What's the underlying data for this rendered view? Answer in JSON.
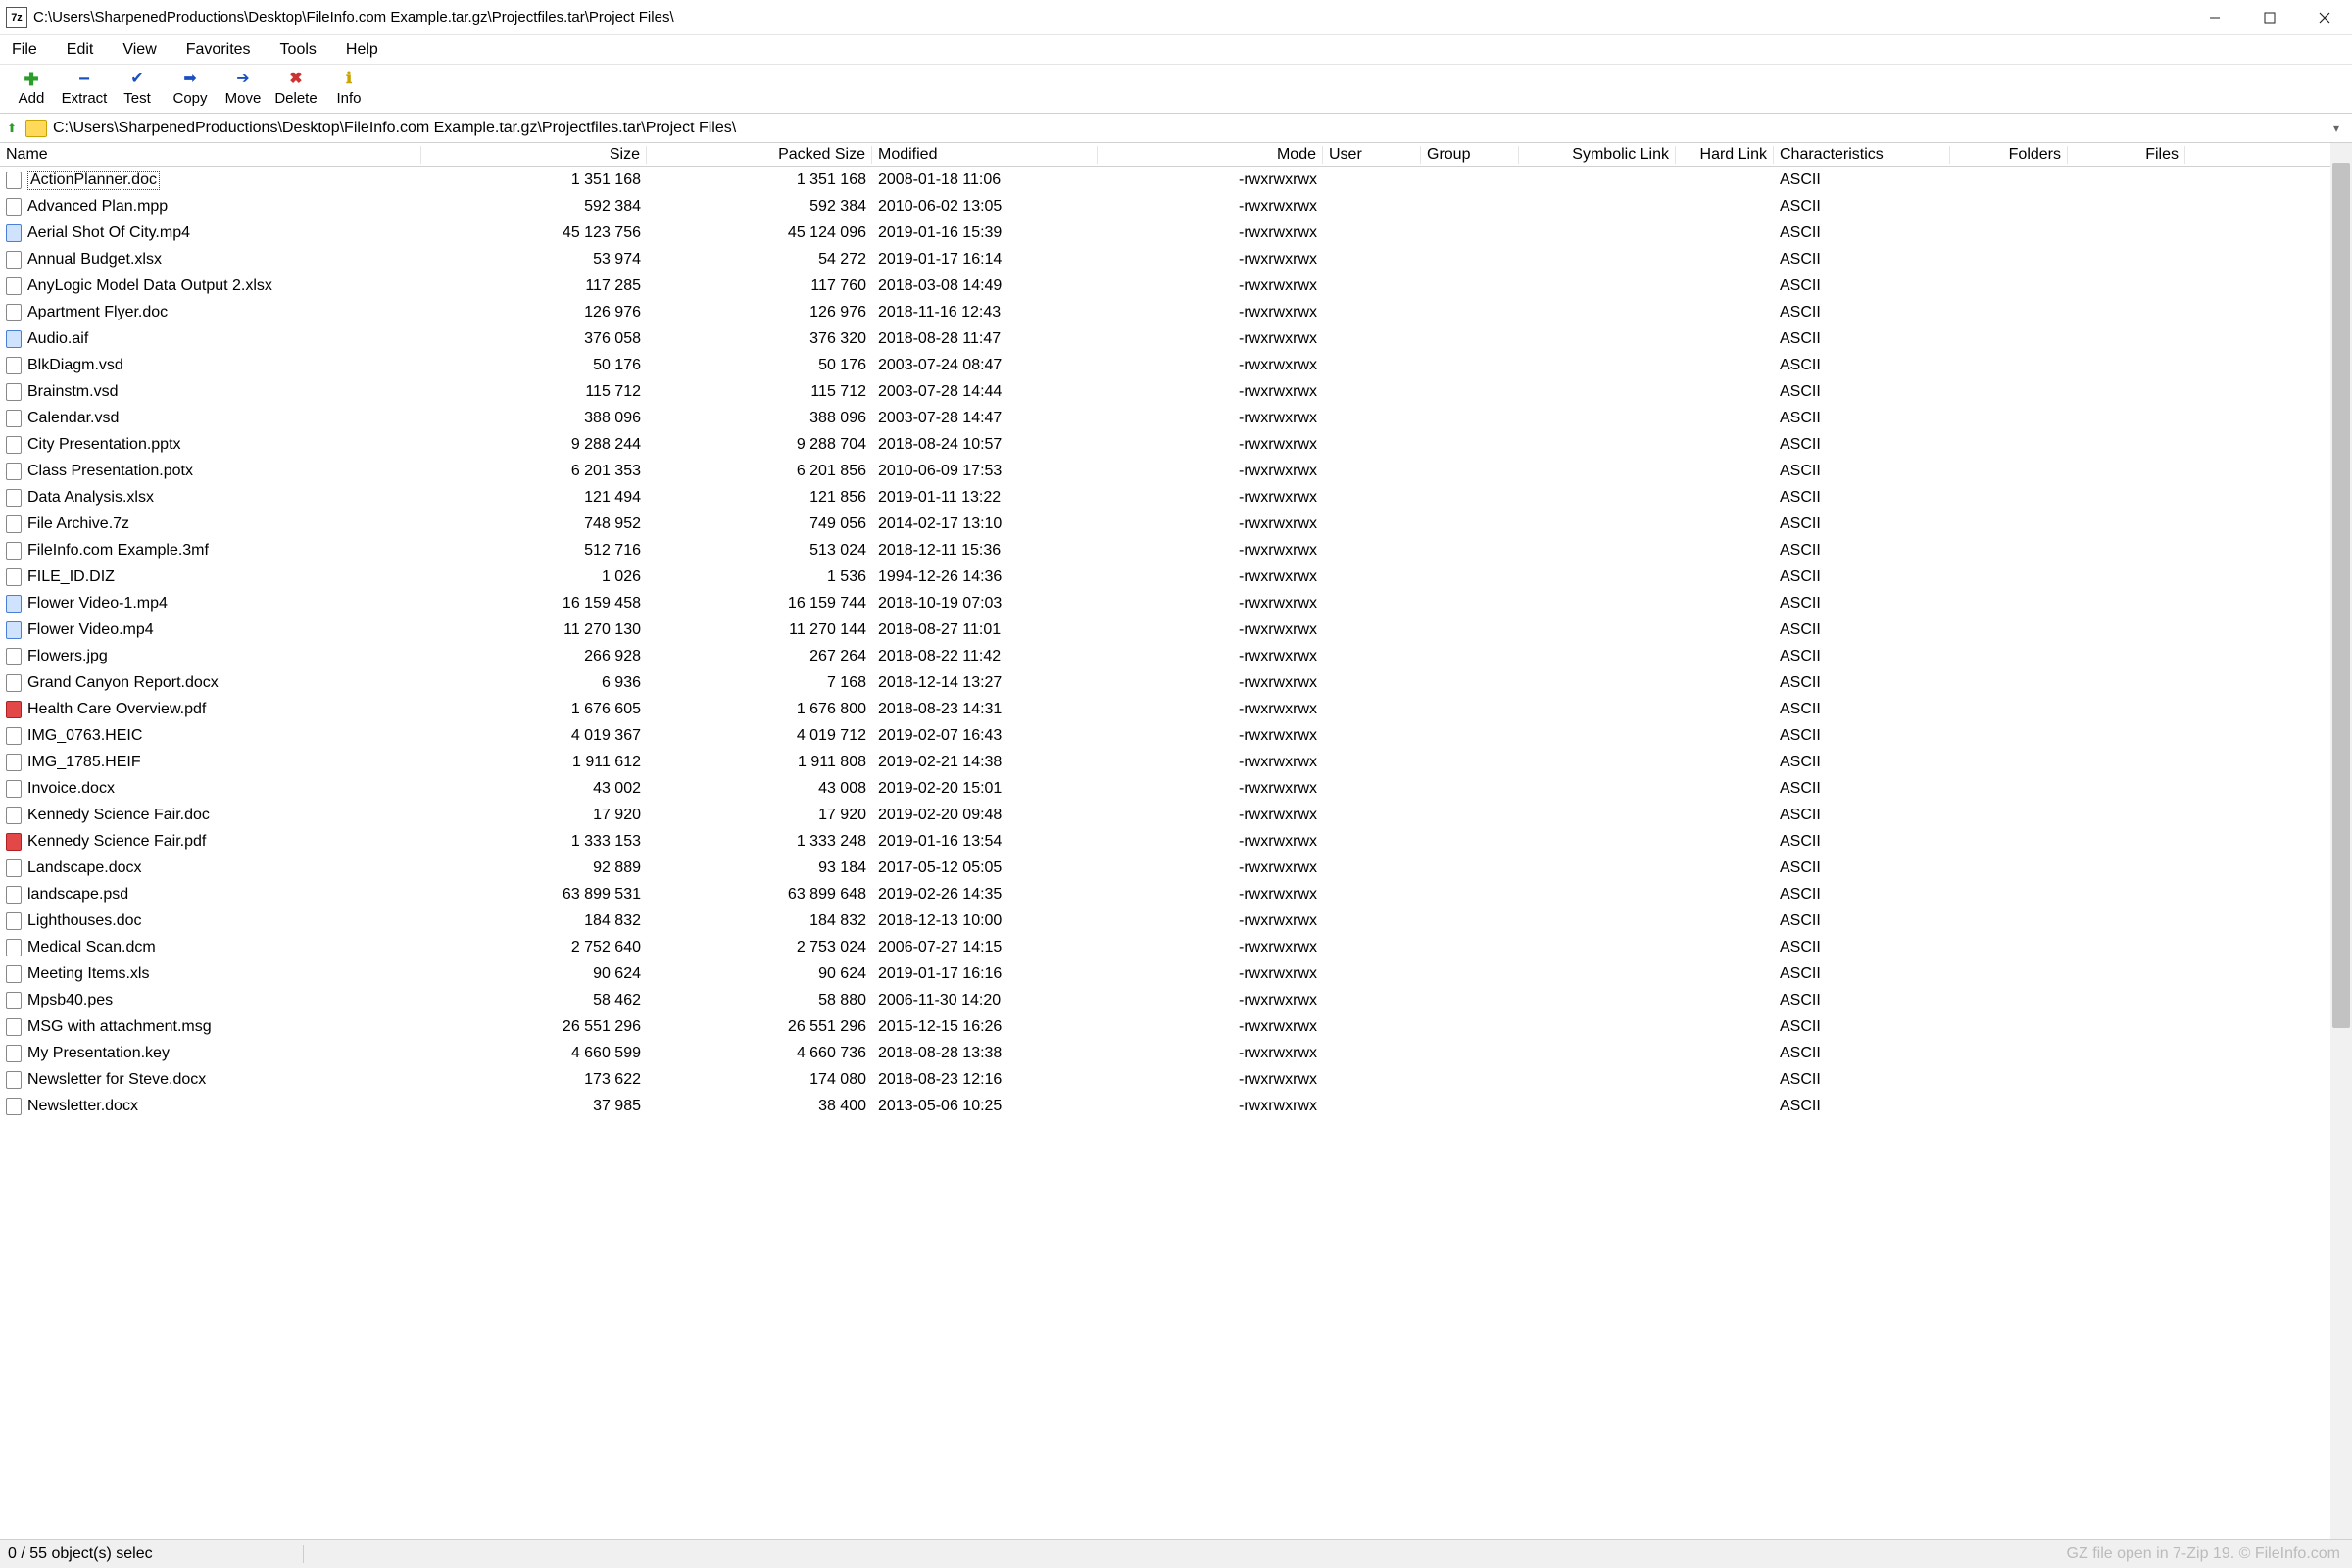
{
  "titlebar": {
    "icon_text": "7z",
    "title": "C:\\Users\\SharpenedProductions\\Desktop\\FileInfo.com Example.tar.gz\\Projectfiles.tar\\Project Files\\"
  },
  "menu": [
    "File",
    "Edit",
    "View",
    "Favorites",
    "Tools",
    "Help"
  ],
  "toolbar": [
    {
      "id": "add",
      "label": "Add",
      "glyph": "✚",
      "cls": "add"
    },
    {
      "id": "extract",
      "label": "Extract",
      "glyph": "−",
      "cls": "extract"
    },
    {
      "id": "test",
      "label": "Test",
      "glyph": "✔",
      "cls": "test"
    },
    {
      "id": "copy",
      "label": "Copy",
      "glyph": "➡",
      "cls": "copy"
    },
    {
      "id": "move",
      "label": "Move",
      "glyph": "➔",
      "cls": "move"
    },
    {
      "id": "delete",
      "label": "Delete",
      "glyph": "✖",
      "cls": "delete"
    },
    {
      "id": "info",
      "label": "Info",
      "glyph": "ℹ",
      "cls": "info"
    }
  ],
  "addressbar": {
    "path": "C:\\Users\\SharpenedProductions\\Desktop\\FileInfo.com Example.tar.gz\\Projectfiles.tar\\Project Files\\"
  },
  "columns": [
    "Name",
    "Size",
    "Packed Size",
    "Modified",
    "Mode",
    "User",
    "Group",
    "Symbolic Link",
    "Hard Link",
    "Characteristics",
    "Folders",
    "Files"
  ],
  "rows": [
    {
      "name": "ActionPlanner.doc",
      "icon": "",
      "size": "1 351 168",
      "psize": "1 351 168",
      "mod": "2008-01-18 11:06",
      "mode": "-rwxrwxrwx",
      "char": "ASCII",
      "selected": true
    },
    {
      "name": "Advanced Plan.mpp",
      "icon": "",
      "size": "592 384",
      "psize": "592 384",
      "mod": "2010-06-02 13:05",
      "mode": "-rwxrwxrwx",
      "char": "ASCII"
    },
    {
      "name": "Aerial Shot Of City.mp4",
      "icon": "blue",
      "size": "45 123 756",
      "psize": "45 124 096",
      "mod": "2019-01-16 15:39",
      "mode": "-rwxrwxrwx",
      "char": "ASCII"
    },
    {
      "name": "Annual Budget.xlsx",
      "icon": "",
      "size": "53 974",
      "psize": "54 272",
      "mod": "2019-01-17 16:14",
      "mode": "-rwxrwxrwx",
      "char": "ASCII"
    },
    {
      "name": "AnyLogic Model Data Output 2.xlsx",
      "icon": "",
      "size": "117 285",
      "psize": "117 760",
      "mod": "2018-03-08 14:49",
      "mode": "-rwxrwxrwx",
      "char": "ASCII"
    },
    {
      "name": "Apartment Flyer.doc",
      "icon": "",
      "size": "126 976",
      "psize": "126 976",
      "mod": "2018-11-16 12:43",
      "mode": "-rwxrwxrwx",
      "char": "ASCII"
    },
    {
      "name": "Audio.aif",
      "icon": "blue",
      "size": "376 058",
      "psize": "376 320",
      "mod": "2018-08-28 11:47",
      "mode": "-rwxrwxrwx",
      "char": "ASCII"
    },
    {
      "name": "BlkDiagm.vsd",
      "icon": "",
      "size": "50 176",
      "psize": "50 176",
      "mod": "2003-07-24 08:47",
      "mode": "-rwxrwxrwx",
      "char": "ASCII"
    },
    {
      "name": "Brainstm.vsd",
      "icon": "",
      "size": "115 712",
      "psize": "115 712",
      "mod": "2003-07-28 14:44",
      "mode": "-rwxrwxrwx",
      "char": "ASCII"
    },
    {
      "name": "Calendar.vsd",
      "icon": "",
      "size": "388 096",
      "psize": "388 096",
      "mod": "2003-07-28 14:47",
      "mode": "-rwxrwxrwx",
      "char": "ASCII"
    },
    {
      "name": "City Presentation.pptx",
      "icon": "",
      "size": "9 288 244",
      "psize": "9 288 704",
      "mod": "2018-08-24 10:57",
      "mode": "-rwxrwxrwx",
      "char": "ASCII"
    },
    {
      "name": "Class Presentation.potx",
      "icon": "",
      "size": "6 201 353",
      "psize": "6 201 856",
      "mod": "2010-06-09 17:53",
      "mode": "-rwxrwxrwx",
      "char": "ASCII"
    },
    {
      "name": "Data Analysis.xlsx",
      "icon": "",
      "size": "121 494",
      "psize": "121 856",
      "mod": "2019-01-11 13:22",
      "mode": "-rwxrwxrwx",
      "char": "ASCII"
    },
    {
      "name": "File Archive.7z",
      "icon": "",
      "size": "748 952",
      "psize": "749 056",
      "mod": "2014-02-17 13:10",
      "mode": "-rwxrwxrwx",
      "char": "ASCII"
    },
    {
      "name": "FileInfo.com Example.3mf",
      "icon": "",
      "size": "512 716",
      "psize": "513 024",
      "mod": "2018-12-11 15:36",
      "mode": "-rwxrwxrwx",
      "char": "ASCII"
    },
    {
      "name": "FILE_ID.DIZ",
      "icon": "",
      "size": "1 026",
      "psize": "1 536",
      "mod": "1994-12-26 14:36",
      "mode": "-rwxrwxrwx",
      "char": "ASCII"
    },
    {
      "name": "Flower Video-1.mp4",
      "icon": "blue",
      "size": "16 159 458",
      "psize": "16 159 744",
      "mod": "2018-10-19 07:03",
      "mode": "-rwxrwxrwx",
      "char": "ASCII"
    },
    {
      "name": "Flower Video.mp4",
      "icon": "blue",
      "size": "11 270 130",
      "psize": "11 270 144",
      "mod": "2018-08-27 11:01",
      "mode": "-rwxrwxrwx",
      "char": "ASCII"
    },
    {
      "name": "Flowers.jpg",
      "icon": "",
      "size": "266 928",
      "psize": "267 264",
      "mod": "2018-08-22 11:42",
      "mode": "-rwxrwxrwx",
      "char": "ASCII"
    },
    {
      "name": "Grand Canyon Report.docx",
      "icon": "",
      "size": "6 936",
      "psize": "7 168",
      "mod": "2018-12-14 13:27",
      "mode": "-rwxrwxrwx",
      "char": "ASCII"
    },
    {
      "name": "Health Care Overview.pdf",
      "icon": "pdf",
      "size": "1 676 605",
      "psize": "1 676 800",
      "mod": "2018-08-23 14:31",
      "mode": "-rwxrwxrwx",
      "char": "ASCII"
    },
    {
      "name": "IMG_0763.HEIC",
      "icon": "",
      "size": "4 019 367",
      "psize": "4 019 712",
      "mod": "2019-02-07 16:43",
      "mode": "-rwxrwxrwx",
      "char": "ASCII"
    },
    {
      "name": "IMG_1785.HEIF",
      "icon": "",
      "size": "1 911 612",
      "psize": "1 911 808",
      "mod": "2019-02-21 14:38",
      "mode": "-rwxrwxrwx",
      "char": "ASCII"
    },
    {
      "name": "Invoice.docx",
      "icon": "",
      "size": "43 002",
      "psize": "43 008",
      "mod": "2019-02-20 15:01",
      "mode": "-rwxrwxrwx",
      "char": "ASCII"
    },
    {
      "name": "Kennedy Science Fair.doc",
      "icon": "",
      "size": "17 920",
      "psize": "17 920",
      "mod": "2019-02-20 09:48",
      "mode": "-rwxrwxrwx",
      "char": "ASCII"
    },
    {
      "name": "Kennedy Science Fair.pdf",
      "icon": "pdf",
      "size": "1 333 153",
      "psize": "1 333 248",
      "mod": "2019-01-16 13:54",
      "mode": "-rwxrwxrwx",
      "char": "ASCII"
    },
    {
      "name": "Landscape.docx",
      "icon": "",
      "size": "92 889",
      "psize": "93 184",
      "mod": "2017-05-12 05:05",
      "mode": "-rwxrwxrwx",
      "char": "ASCII"
    },
    {
      "name": "landscape.psd",
      "icon": "",
      "size": "63 899 531",
      "psize": "63 899 648",
      "mod": "2019-02-26 14:35",
      "mode": "-rwxrwxrwx",
      "char": "ASCII"
    },
    {
      "name": "Lighthouses.doc",
      "icon": "",
      "size": "184 832",
      "psize": "184 832",
      "mod": "2018-12-13 10:00",
      "mode": "-rwxrwxrwx",
      "char": "ASCII"
    },
    {
      "name": "Medical Scan.dcm",
      "icon": "",
      "size": "2 752 640",
      "psize": "2 753 024",
      "mod": "2006-07-27 14:15",
      "mode": "-rwxrwxrwx",
      "char": "ASCII"
    },
    {
      "name": "Meeting Items.xls",
      "icon": "",
      "size": "90 624",
      "psize": "90 624",
      "mod": "2019-01-17 16:16",
      "mode": "-rwxrwxrwx",
      "char": "ASCII"
    },
    {
      "name": "Mpsb40.pes",
      "icon": "",
      "size": "58 462",
      "psize": "58 880",
      "mod": "2006-11-30 14:20",
      "mode": "-rwxrwxrwx",
      "char": "ASCII"
    },
    {
      "name": "MSG with attachment.msg",
      "icon": "",
      "size": "26 551 296",
      "psize": "26 551 296",
      "mod": "2015-12-15 16:26",
      "mode": "-rwxrwxrwx",
      "char": "ASCII"
    },
    {
      "name": "My Presentation.key",
      "icon": "",
      "size": "4 660 599",
      "psize": "4 660 736",
      "mod": "2018-08-28 13:38",
      "mode": "-rwxrwxrwx",
      "char": "ASCII"
    },
    {
      "name": "Newsletter for Steve.docx",
      "icon": "",
      "size": "173 622",
      "psize": "174 080",
      "mod": "2018-08-23 12:16",
      "mode": "-rwxrwxrwx",
      "char": "ASCII"
    },
    {
      "name": "Newsletter.docx",
      "icon": "",
      "size": "37 985",
      "psize": "38 400",
      "mod": "2013-05-06 10:25",
      "mode": "-rwxrwxrwx",
      "char": "ASCII"
    }
  ],
  "status": {
    "left": "0 / 55 object(s) selec",
    "right": "GZ file open in 7-Zip 19. © FileInfo.com"
  }
}
